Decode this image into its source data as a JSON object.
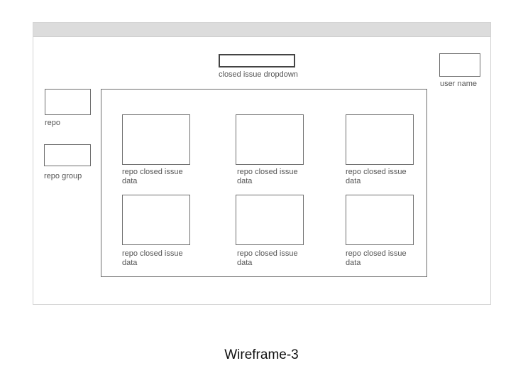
{
  "dropdown": {
    "label": "closed issue dropdown"
  },
  "user": {
    "label": "user name"
  },
  "filters": {
    "repo_label": "repo",
    "repo_group_label": "repo group"
  },
  "cards": [
    {
      "label": "repo closed issue data"
    },
    {
      "label": "repo closed issue data"
    },
    {
      "label": "repo closed issue data"
    },
    {
      "label": "repo closed issue data"
    },
    {
      "label": "repo closed issue data"
    },
    {
      "label": "repo closed issue data"
    }
  ],
  "caption": "Wireframe-3"
}
